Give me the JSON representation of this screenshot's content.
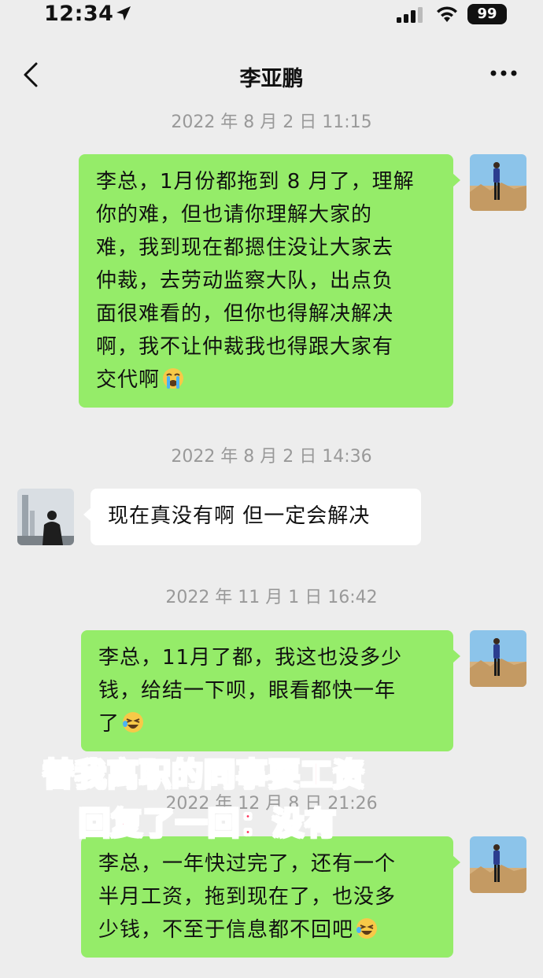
{
  "status_bar": {
    "time": "12:34",
    "battery": "99",
    "icons": [
      "location-arrow-icon",
      "signal-icon",
      "wifi-icon",
      "battery-icon"
    ]
  },
  "nav": {
    "title": "李亚鹏",
    "icons": [
      "back-chevron-icon",
      "more-dots-icon"
    ]
  },
  "messages": [
    {
      "timestamp": "2022 年 8 月 2 日 11:15",
      "sender": "me",
      "lines": [
        "李总，1月份都拖到 8 月了，理解",
        "你的难，但也请你理解大家的",
        "难，我到现在都摁住没让大家去",
        "仲裁，去劳动监察大队，出点负",
        "面很难看的，但你也得解决解决",
        "啊，我不让仲裁我也得跟大家有",
        "交代啊"
      ],
      "emoji": "loudly-crying-face"
    },
    {
      "timestamp": "2022 年 8 月 2 日 14:36",
      "sender": "them",
      "lines": [
        "现在真没有啊 但一定会解决"
      ],
      "emoji": ""
    },
    {
      "timestamp": "2022 年 11 月 1 日 16:42",
      "sender": "me",
      "lines": [
        "李总，11月了都，我这也没多少",
        "钱，给结一下呗，眼看都快一年",
        "了"
      ],
      "emoji": "rolling-laughing-face"
    },
    {
      "timestamp": "2022 年 12 月 8 日 21:26",
      "sender": "me",
      "lines": [
        "李总，一年快过完了，还有一个",
        "半月工资，拖到现在了，也没多",
        "少钱，不至于信息都不回吧"
      ],
      "emoji": "rolling-laughing-face"
    }
  ],
  "overlay_caption": {
    "line1": "替我离职的同事要工资",
    "line2": "回复了一回：没有",
    "color": "#ff2d55"
  },
  "colors": {
    "my_bubble": "#95ec69",
    "their_bubble": "#ffffff",
    "background": "#ededed",
    "timestamp": "#999999"
  }
}
